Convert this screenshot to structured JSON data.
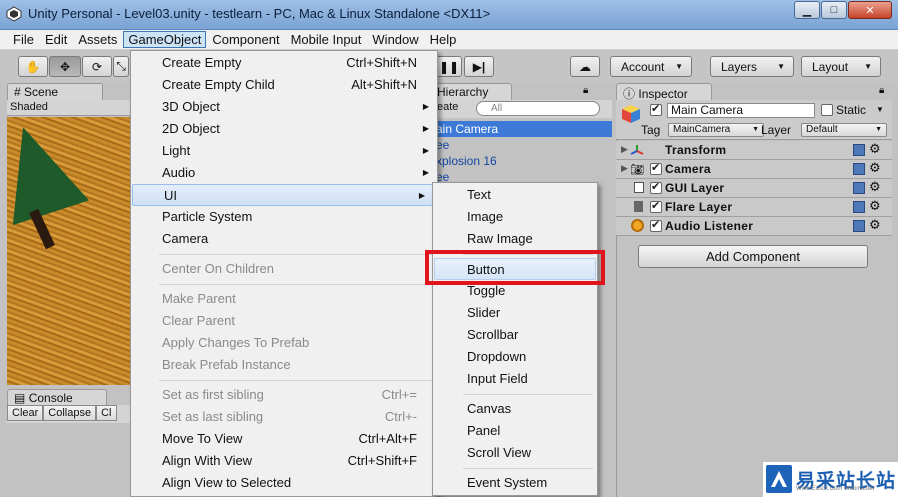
{
  "window": {
    "title": "Unity Personal - Level03.unity - testlearn - PC, Mac & Linux Standalone <DX11>",
    "controls": [
      "minimize",
      "maximize",
      "close"
    ]
  },
  "menubar": {
    "items": [
      "File",
      "Edit",
      "Assets",
      "GameObject",
      "Component",
      "Mobile Input",
      "Window",
      "Help"
    ],
    "active": "GameObject"
  },
  "toolbar": {
    "tools": [
      "hand-tool",
      "move-tool",
      "rotate-tool",
      "scale-tool"
    ],
    "play_controls": [
      "pause",
      "step"
    ],
    "cloud_icon": "cloud-icon",
    "account_label": "Account",
    "layers_label": "Layers",
    "layout_label": "Layout"
  },
  "scene": {
    "tab_label": "Scene",
    "shading_mode": "Shaded"
  },
  "console": {
    "tab_label": "Console",
    "clear_label": "Clear",
    "collapse_label": "Collapse",
    "clear_on_play_label": "Cl"
  },
  "hierarchy": {
    "tab_label": "Hierarchy",
    "create_label": "eate",
    "search_placeholder": "All",
    "rows": [
      {
        "label": "ain Camera",
        "selected": true
      },
      {
        "label": "ee",
        "selected": false
      },
      {
        "label": "xplosion 16",
        "selected": false
      },
      {
        "label": "ee",
        "selected": false
      }
    ]
  },
  "inspector": {
    "tab_label": "Inspector",
    "object_name": "Main Camera",
    "static_label": "Static",
    "tag_label": "Tag",
    "tag_value": "MainCamera",
    "layer_label": "Layer",
    "layer_value": "Default",
    "components": [
      {
        "name": "Transform",
        "icon": "transform-icon",
        "has_checkbox": false
      },
      {
        "name": "Camera",
        "icon": "camera-icon",
        "has_checkbox": true
      },
      {
        "name": "GUI Layer",
        "icon": "gui-layer-icon",
        "has_checkbox": true
      },
      {
        "name": "Flare Layer",
        "icon": "flare-layer-icon",
        "has_checkbox": true
      },
      {
        "name": "Audio Listener",
        "icon": "audio-listener-icon",
        "has_checkbox": true
      }
    ],
    "add_component_label": "Add Component"
  },
  "gameobject_menu": {
    "items": [
      {
        "label": "Create Empty",
        "shortcut": "Ctrl+Shift+N"
      },
      {
        "label": "Create Empty Child",
        "shortcut": "Alt+Shift+N"
      },
      {
        "label": "3D Object",
        "submenu": true
      },
      {
        "label": "2D Object",
        "submenu": true
      },
      {
        "label": "Light",
        "submenu": true
      },
      {
        "label": "Audio",
        "submenu": true
      },
      {
        "label": "UI",
        "submenu": true,
        "highlighted": true
      },
      {
        "label": "Particle System"
      },
      {
        "label": "Camera"
      },
      {
        "label": "Center On Children",
        "disabled": true
      },
      {
        "label": "Make Parent",
        "disabled": true
      },
      {
        "label": "Clear Parent",
        "disabled": true
      },
      {
        "label": "Apply Changes To Prefab",
        "disabled": true
      },
      {
        "label": "Break Prefab Instance",
        "disabled": true
      },
      {
        "label": "Set as first sibling",
        "shortcut": "Ctrl+=",
        "disabled": true
      },
      {
        "label": "Set as last sibling",
        "shortcut": "Ctrl+-",
        "disabled": true
      },
      {
        "label": "Move To View",
        "shortcut": "Ctrl+Alt+F"
      },
      {
        "label": "Align With View",
        "shortcut": "Ctrl+Shift+F"
      },
      {
        "label": "Align View to Selected"
      }
    ]
  },
  "ui_submenu": {
    "items": [
      "Text",
      "Image",
      "Raw Image",
      "Button",
      "Toggle",
      "Slider",
      "Scrollbar",
      "Dropdown",
      "Input Field",
      "Canvas",
      "Panel",
      "Scroll View",
      "Event System"
    ],
    "highlighted": "Button",
    "highlight_color": "#e0141a"
  },
  "watermark": {
    "text": "易采站长站",
    "small": "Www.Easck.Com  Webmaster"
  }
}
